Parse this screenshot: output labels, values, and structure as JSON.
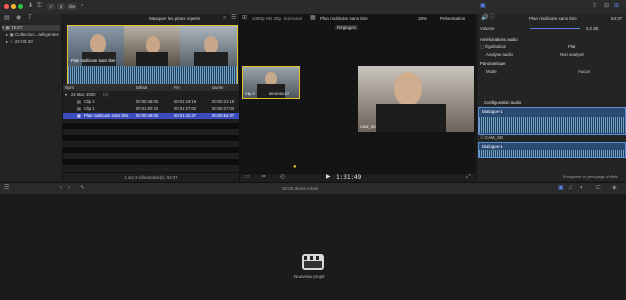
{
  "titlebar": {
    "button_on": "On"
  },
  "library": {
    "items": [
      {
        "label": "TEST",
        "selected": true
      },
      {
        "label": "Collection...telligentes",
        "selected": false
      },
      {
        "label": "22-03-20",
        "selected": false
      }
    ]
  },
  "browser": {
    "filter_label": "Masquer les plans rejetés",
    "thumb_caption": "Plan multicam sans titre",
    "columns": [
      "Nom",
      "Début",
      "Fin",
      "Durée"
    ],
    "group_label": "22 Mar. 2020",
    "group_count": "(3)",
    "rows": [
      {
        "name": "Clip 2",
        "start": "00:00:48:00",
        "end": "00:01:19:19",
        "dur": "00:00:31:19",
        "selected": false
      },
      {
        "name": "Clip 1",
        "start": "00:01:00:34",
        "end": "00:01:27:02",
        "dur": "00:00:27:03",
        "selected": false
      },
      {
        "name": "Plan multicam sans titre",
        "start": "00:00:48:00",
        "end": "00:01:42:37",
        "dur": "00:00:54:37",
        "selected": true
      }
    ],
    "status": "1 sur 3 sélectionné(s), 54:37"
  },
  "viewer": {
    "format": "1080p HD 30p, Surround",
    "title": "Plan multicam sans titre",
    "zoom": "18%",
    "presentation": "Présentation",
    "settings": "Réglages",
    "angle1_label": "Clip 2",
    "angle1_tc": "00:00:54:37",
    "angle2_label": "CAM_SD",
    "timecode": "1:31:49"
  },
  "inspector": {
    "title": "Plan multicam sans titre",
    "tc": "54:37",
    "volume_label": "Volume",
    "volume_value": "0,0 dB",
    "enhance_header": "Améliorations audio",
    "equalization_label": "Égalisation",
    "equalization_value": "Plat",
    "analysis_label": "Analyse audio",
    "analysis_value": "Non analysé",
    "pan_header": "Panoramique",
    "mode_label": "Mode",
    "mode_value": "Aucun",
    "config_header": "Configuration audio",
    "lane1": "Dialogue-1",
    "cam_label": "CAM_SD",
    "lane2": "Dialogue-1",
    "footer_btn": "Enregistrer le préréglage d'effets"
  },
  "timeline": {
    "duration_label": "00:00 durée totale",
    "empty_label": "Nouveau projet"
  },
  "colors": {
    "accent": "#3b4cc0",
    "selection": "#e2c12b",
    "wave": "#6fa0c4"
  }
}
